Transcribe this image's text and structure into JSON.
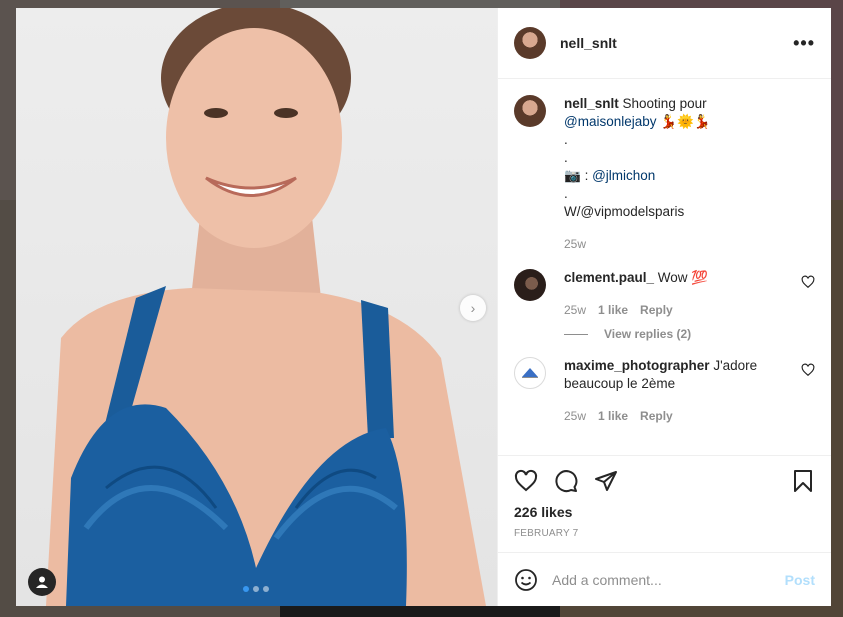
{
  "post": {
    "username": "nell_snlt",
    "more_label": "•••"
  },
  "caption": {
    "username": "nell_snlt",
    "text_before": "Shooting pour",
    "mention1": "@maisonlejaby",
    "emojis1": "💃🌞💃",
    "dot1": ".",
    "dot2": ".",
    "camera_emoji": "📷",
    "camera_sep": " : ",
    "mention2": "@jlmichon",
    "dot3": ".",
    "agency": "W/@vipmodelsparis",
    "time": "25w"
  },
  "comments": [
    {
      "username": "clement.paul_",
      "text": "Wow",
      "emoji": "💯",
      "time": "25w",
      "likes": "1 like",
      "reply": "Reply",
      "view_replies": "View replies (2)"
    },
    {
      "username": "maxime_photographer",
      "text": "J'adore beaucoup le 2ème",
      "time": "25w",
      "likes": "1 like",
      "reply": "Reply"
    }
  ],
  "actions": {
    "likes": "226 likes",
    "date": "FEBRUARY 7"
  },
  "composer": {
    "placeholder": "Add a comment...",
    "post_label": "Post"
  },
  "carousel": {
    "current": 1,
    "total": 3,
    "next_glyph": "›"
  },
  "colors": {
    "accent": "#3897f0",
    "post_disabled": "#b2dffc",
    "link": "#00376b",
    "muted": "#8e8e8e"
  }
}
